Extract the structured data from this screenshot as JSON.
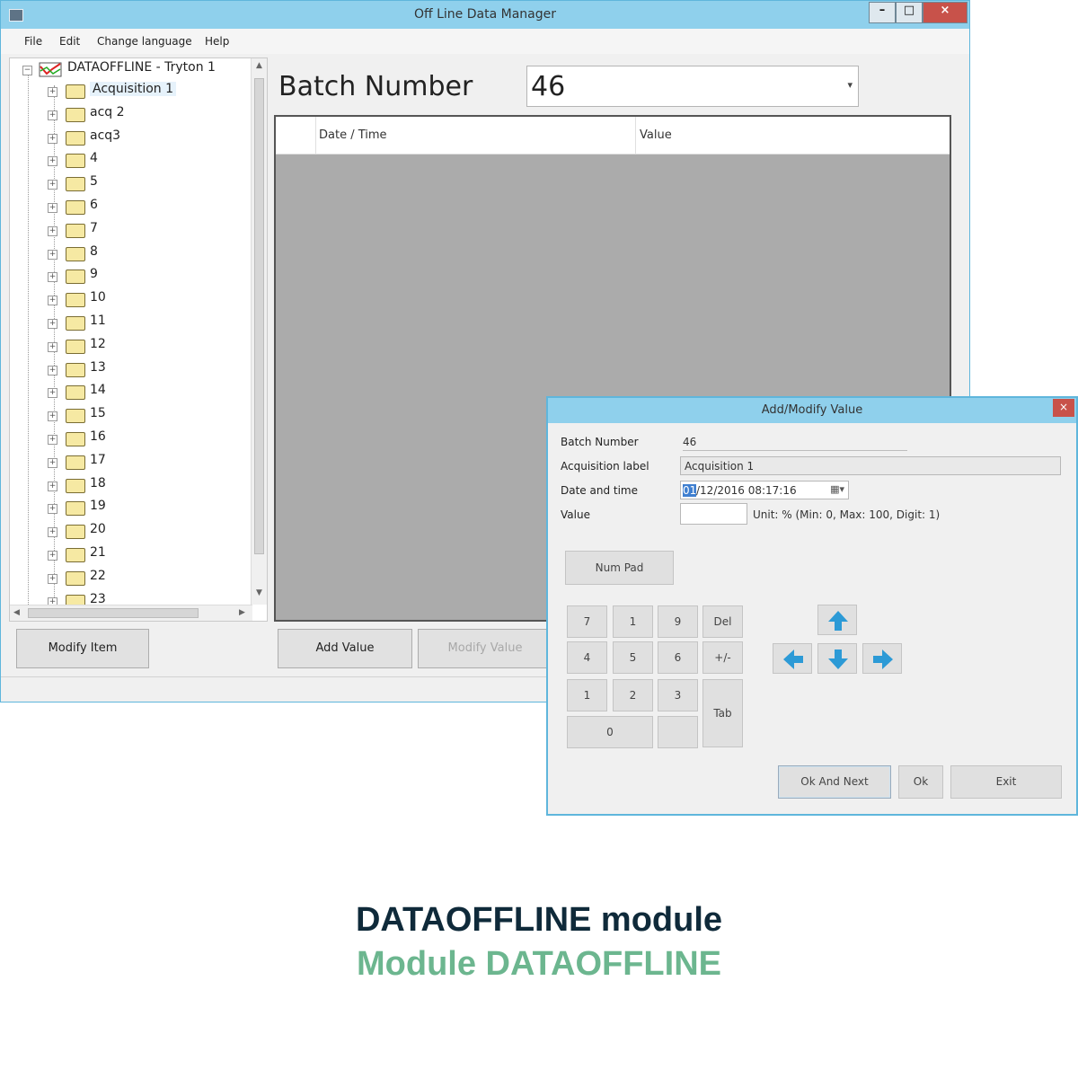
{
  "window": {
    "title": "Off Line Data Manager",
    "minimize": "–",
    "maximize": "□",
    "close": "×"
  },
  "menu": [
    "File",
    "Edit",
    "Change language",
    "Help"
  ],
  "tree": {
    "root": "DATAOFFLINE - Tryton 1",
    "items": [
      "Acquisition 1",
      "acq 2",
      "acq3",
      "4",
      "5",
      "6",
      "7",
      "8",
      "9",
      "10",
      "11",
      "12",
      "13",
      "14",
      "15",
      "16",
      "17",
      "18",
      "19",
      "20",
      "21",
      "22",
      "23"
    ]
  },
  "batch": {
    "label": "Batch Number",
    "value": "46"
  },
  "grid": {
    "columns": [
      "Date / Time",
      "Value"
    ]
  },
  "buttons": {
    "modify_item": "Modify Item",
    "add_value": "Add Value",
    "modify_value": "Modify Value"
  },
  "dialog": {
    "title": "Add/Modify Value",
    "close": "×",
    "labels": {
      "batch_number": "Batch Number",
      "acquisition_label": "Acquisition label",
      "date_time": "Date and time",
      "value": "Value"
    },
    "values": {
      "batch_number": "46",
      "acquisition": "Acquisition 1",
      "date_time_highlight": "01",
      "date_time_rest": "/12/2016 08:17:16",
      "value": "",
      "unit_hint": "Unit: % (Min: 0, Max: 100, Digit: 1)"
    },
    "num_pad_label": "Num Pad",
    "keypad": {
      "row1": [
        "7",
        "1",
        "9",
        "Del"
      ],
      "row2": [
        "4",
        "5",
        "6",
        "+/-"
      ],
      "row3": [
        "1",
        "2",
        "3"
      ],
      "zero": "0",
      "tab": "Tab"
    },
    "buttons": {
      "ok_next": "Ok And Next",
      "ok": "Ok",
      "exit": "Exit"
    },
    "arrow_color": "#2c9ad6"
  },
  "caption": {
    "line1": "DATAOFFLINE module",
    "line2": "Module DATAOFFLINE",
    "line1_color": "#0f2a3a",
    "line2_color": "#6cb68f"
  }
}
